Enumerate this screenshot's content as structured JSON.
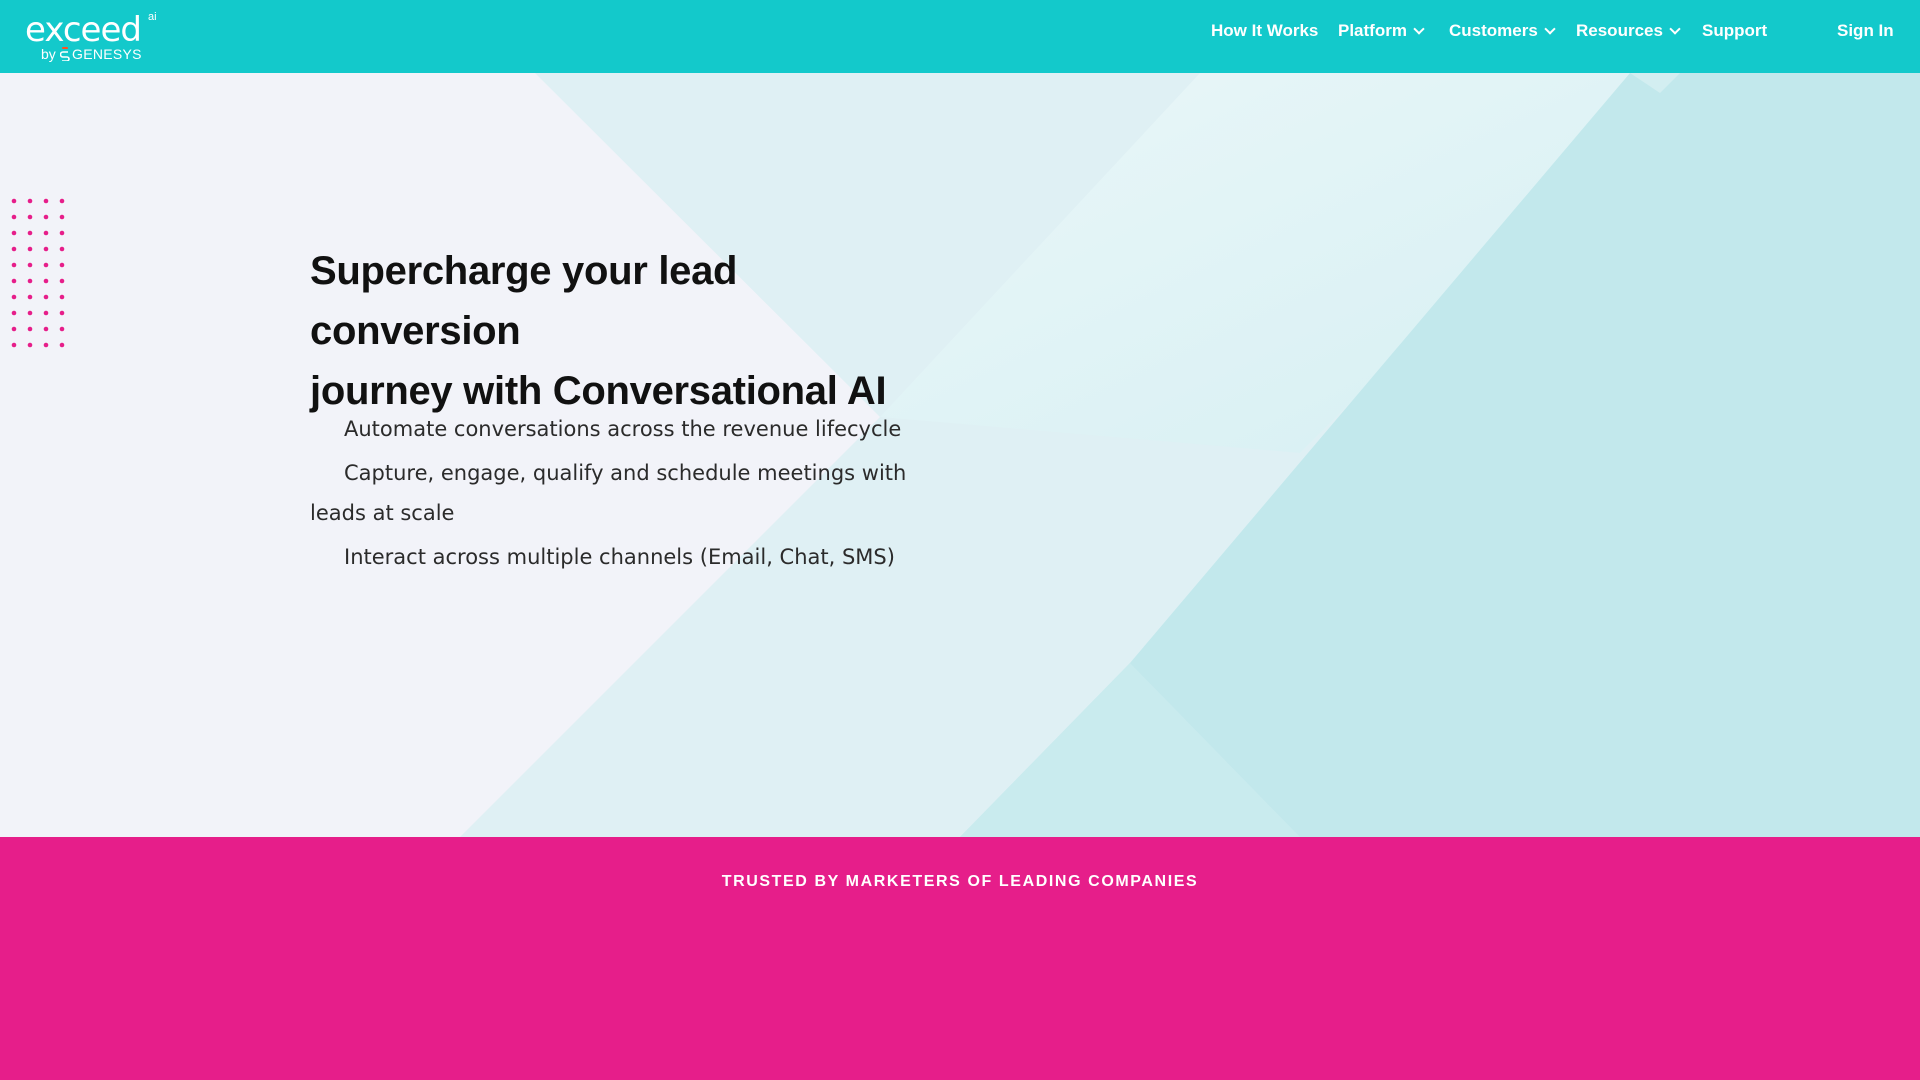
{
  "brand": {
    "logo_word": "exceed",
    "logo_superscript": "ai",
    "logo_by": "by",
    "logo_company": "GENESYS",
    "primary_color": "#13c9cb",
    "accent_color": "#e61e8a"
  },
  "nav": {
    "how_it_works": "How It Works",
    "platform": "Platform",
    "customers": "Customers",
    "resources": "Resources",
    "support": "Support",
    "sign_in": "Sign In",
    "dropdown_icon": "chevron-down-icon"
  },
  "hero": {
    "title_line1": "Supercharge your lead conversion",
    "title_line2": "journey with Conversational AI",
    "bullets": [
      "Automate conversations across the revenue lifecycle",
      "Capture, engage, qualify and schedule meetings with leads at scale",
      "Interact across multiple channels (Email, Chat, SMS)"
    ],
    "decoration": "dot-grid-pattern"
  },
  "trusted": {
    "title": "TRUSTED BY MARKETERS OF LEADING COMPANIES"
  }
}
